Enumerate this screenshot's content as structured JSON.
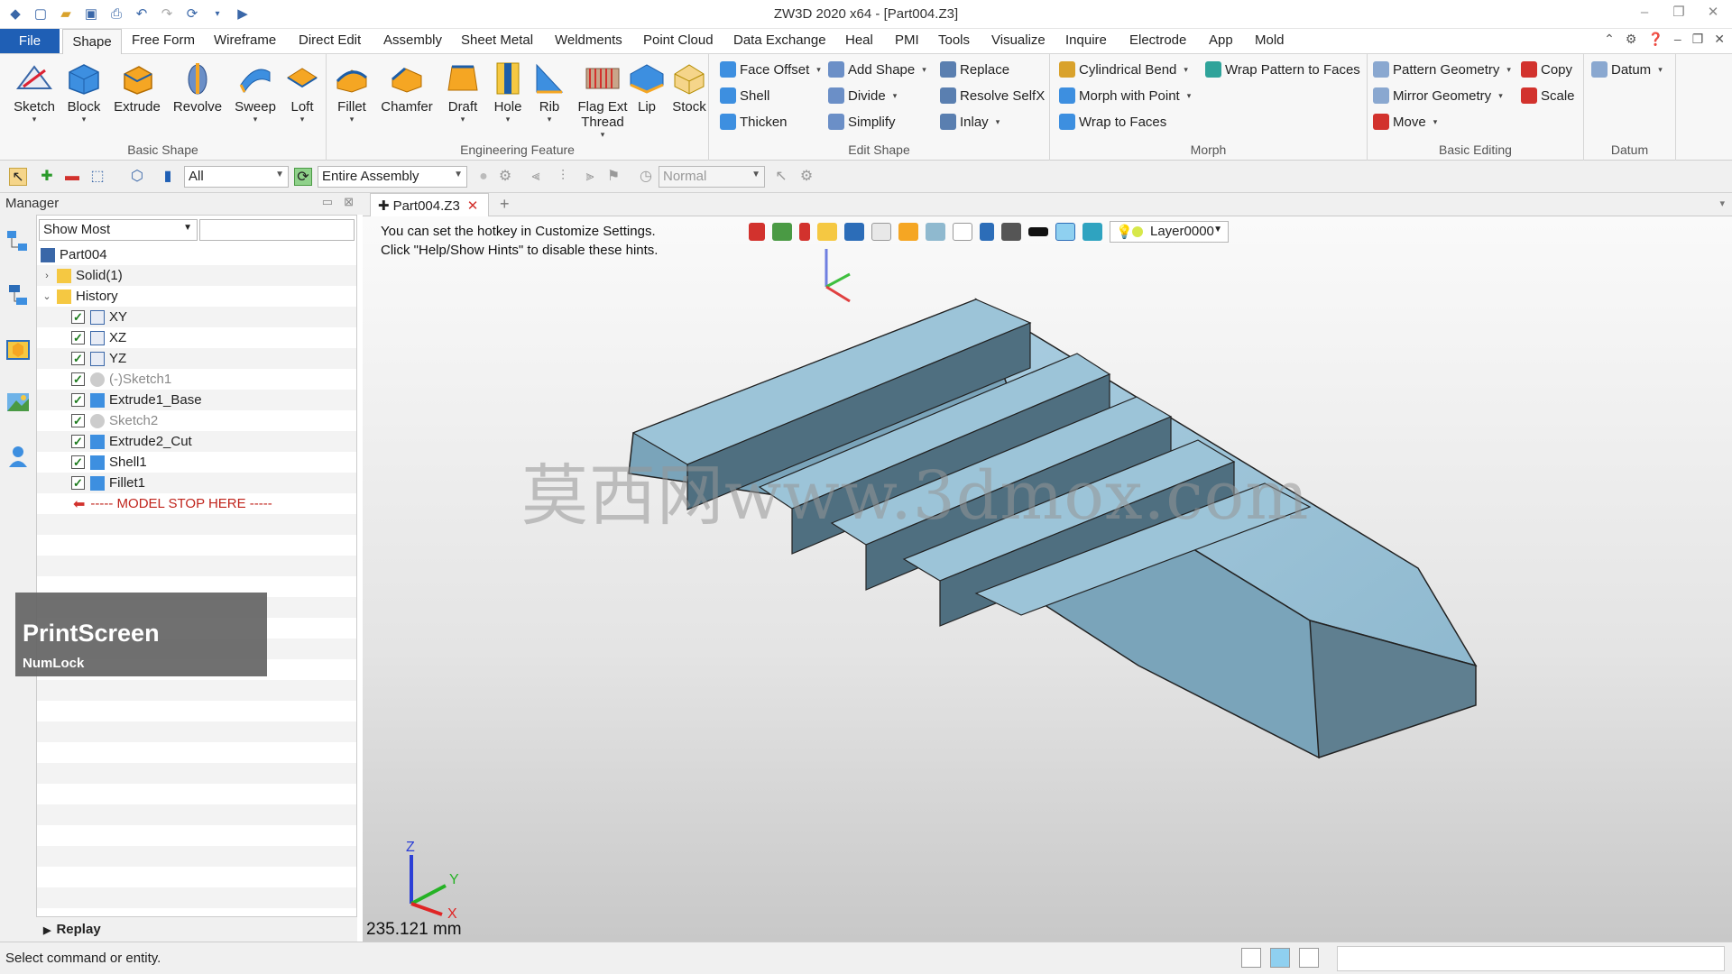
{
  "window": {
    "title": "ZW3D 2020 x64 - [Part004.Z3]"
  },
  "menu": {
    "file": "File",
    "items": [
      "Shape",
      "Free Form",
      "Wireframe",
      "Direct Edit",
      "Assembly",
      "Sheet Metal",
      "Weldments",
      "Point Cloud",
      "Data Exchange",
      "Heal",
      "PMI",
      "Tools",
      "Visualize",
      "Inquire",
      "Electrode",
      "App",
      "Mold"
    ]
  },
  "ribbon": {
    "basic_shape": {
      "label": "Basic Shape",
      "buttons": [
        "Sketch",
        "Block",
        "Extrude",
        "Revolve",
        "Sweep",
        "Loft"
      ]
    },
    "engineering_feature": {
      "label": "Engineering Feature",
      "buttons": [
        "Fillet",
        "Chamfer",
        "Draft",
        "Hole",
        "Rib",
        "Flag Ext Thread",
        "Lip",
        "Stock"
      ]
    },
    "edit_shape": {
      "label": "Edit Shape",
      "col1": [
        "Face Offset",
        "Shell",
        "Thicken"
      ],
      "col2": [
        "Add Shape",
        "Divide",
        "Simplify"
      ],
      "col3": [
        "Replace",
        "Resolve SelfX",
        "Inlay"
      ]
    },
    "morph": {
      "label": "Morph",
      "col1": [
        "Cylindrical Bend",
        "Morph with Point",
        "Wrap to Faces"
      ],
      "col2": [
        "Wrap Pattern to Faces"
      ]
    },
    "basic_editing": {
      "label": "Basic Editing",
      "col1": [
        "Pattern Geometry",
        "Mirror Geometry",
        "Move"
      ],
      "col2": [
        "Copy",
        "Scale"
      ]
    },
    "datum": {
      "label": "Datum",
      "button": "Datum"
    }
  },
  "toolbar": {
    "filter": "All",
    "scope": "Entire Assembly",
    "render_mode": "Normal"
  },
  "manager": {
    "title": "Manager",
    "filter": "Show Most",
    "tree": [
      {
        "label": "Part004",
        "level": 0
      },
      {
        "label": "Solid(1)",
        "level": 1
      },
      {
        "label": "History",
        "level": 1
      },
      {
        "label": "XY",
        "level": 2
      },
      {
        "label": "XZ",
        "level": 2
      },
      {
        "label": "YZ",
        "level": 2
      },
      {
        "label": "(-)Sketch1",
        "level": 2
      },
      {
        "label": "Extrude1_Base",
        "level": 2
      },
      {
        "label": "Sketch2",
        "level": 2
      },
      {
        "label": "Extrude2_Cut",
        "level": 2
      },
      {
        "label": "Shell1",
        "level": 2
      },
      {
        "label": "Fillet1",
        "level": 2
      },
      {
        "label": "----- MODEL STOP HERE -----",
        "level": 2
      }
    ],
    "replay": "Replay"
  },
  "overlay": {
    "title": "PrintScreen",
    "subtitle": "NumLock"
  },
  "document": {
    "tab": "Part004.Z3"
  },
  "viewport": {
    "hint_line1": "You can set the hotkey in Customize Settings.",
    "hint_line2": "Click \"Help/Show Hints\" to disable these hints.",
    "layer": "Layer0000",
    "watermark": "莫西网www.3dmox.com",
    "measurement": "235.121 mm",
    "axes": {
      "x": "X",
      "y": "Y",
      "z": "Z"
    }
  },
  "status": {
    "text": "Select command or entity."
  },
  "colors": {
    "accent": "#1f5fb5",
    "model_face": "#8fb9cf",
    "model_shadow": "#4f6f80"
  }
}
